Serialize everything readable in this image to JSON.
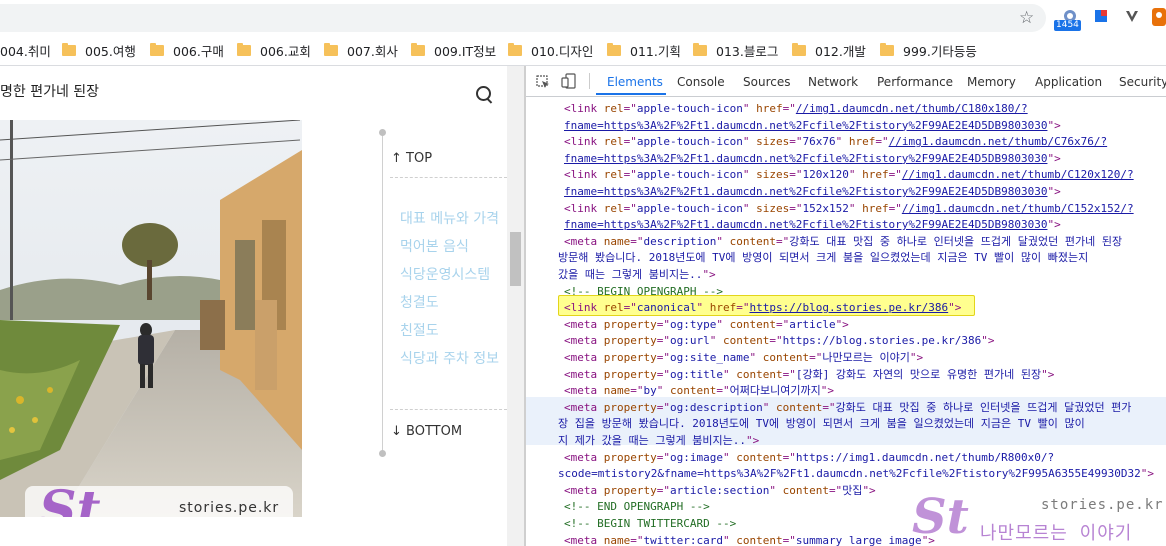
{
  "toolbar": {
    "extension_badge": "1454"
  },
  "bookmarks": [
    {
      "label": "004.취미"
    },
    {
      "label": "005.여행"
    },
    {
      "label": "006.구매"
    },
    {
      "label": "006.교회"
    },
    {
      "label": "007.회사"
    },
    {
      "label": "009.IT정보"
    },
    {
      "label": "010.디자인"
    },
    {
      "label": "011.기획"
    },
    {
      "label": "013.블로그"
    },
    {
      "label": "012.개발"
    },
    {
      "label": "999.기타등등"
    }
  ],
  "blog": {
    "title": "명한 편가네 된장",
    "toc_top": "↑ TOP",
    "toc_bottom": "↓ BOTTOM",
    "toc_items": [
      "대표 메뉴와 가격",
      "먹어본 음식",
      "식당운영시스템",
      "청결도",
      "친절도",
      "식당과 주차 정보"
    ],
    "watermark": {
      "logo": "St",
      "domain": "stories.pe.kr",
      "name": "나만모르는 이야기"
    }
  },
  "devtools": {
    "tabs": [
      "Elements",
      "Console",
      "Sources",
      "Network",
      "Performance",
      "Memory",
      "Application",
      "Security"
    ],
    "active_tab": "Elements",
    "lines": [
      [
        [
          "tag",
          "<link "
        ],
        [
          "attr",
          "rel"
        ],
        [
          "tag",
          "=\""
        ],
        [
          "val",
          "apple-touch-icon"
        ],
        [
          "tag",
          "\" "
        ],
        [
          "attr",
          "href"
        ],
        [
          "tag",
          "=\""
        ],
        [
          "link",
          "//img1.daumcdn.net/thumb/C180x180/?"
        ]
      ],
      [
        [
          "link",
          "fname=https%3A%2F%2Ft1.daumcdn.net%2Fcfile%2Ftistory%2F99AE2E4D5DB9803030"
        ],
        [
          "tag",
          "\">"
        ]
      ],
      [
        [
          "tag",
          "<link "
        ],
        [
          "attr",
          "rel"
        ],
        [
          "tag",
          "=\""
        ],
        [
          "val",
          "apple-touch-icon"
        ],
        [
          "tag",
          "\" "
        ],
        [
          "attr",
          "sizes"
        ],
        [
          "tag",
          "=\""
        ],
        [
          "val",
          "76x76"
        ],
        [
          "tag",
          "\" "
        ],
        [
          "attr",
          "href"
        ],
        [
          "tag",
          "=\""
        ],
        [
          "link",
          "//img1.daumcdn.net/thumb/C76x76/?"
        ]
      ],
      [
        [
          "link",
          "fname=https%3A%2F%2Ft1.daumcdn.net%2Fcfile%2Ftistory%2F99AE2E4D5DB9803030"
        ],
        [
          "tag",
          "\">"
        ]
      ],
      [
        [
          "tag",
          "<link "
        ],
        [
          "attr",
          "rel"
        ],
        [
          "tag",
          "=\""
        ],
        [
          "val",
          "apple-touch-icon"
        ],
        [
          "tag",
          "\" "
        ],
        [
          "attr",
          "sizes"
        ],
        [
          "tag",
          "=\""
        ],
        [
          "val",
          "120x120"
        ],
        [
          "tag",
          "\" "
        ],
        [
          "attr",
          "href"
        ],
        [
          "tag",
          "=\""
        ],
        [
          "link",
          "//img1.daumcdn.net/thumb/C120x120/?"
        ]
      ],
      [
        [
          "link",
          "fname=https%3A%2F%2Ft1.daumcdn.net%2Fcfile%2Ftistory%2F99AE2E4D5DB9803030"
        ],
        [
          "tag",
          "\">"
        ]
      ],
      [
        [
          "tag",
          "<link "
        ],
        [
          "attr",
          "rel"
        ],
        [
          "tag",
          "=\""
        ],
        [
          "val",
          "apple-touch-icon"
        ],
        [
          "tag",
          "\" "
        ],
        [
          "attr",
          "sizes"
        ],
        [
          "tag",
          "=\""
        ],
        [
          "val",
          "152x152"
        ],
        [
          "tag",
          "\" "
        ],
        [
          "attr",
          "href"
        ],
        [
          "tag",
          "=\""
        ],
        [
          "link",
          "//img1.daumcdn.net/thumb/C152x152/?"
        ]
      ],
      [
        [
          "link",
          "fname=https%3A%2F%2Ft1.daumcdn.net%2Fcfile%2Ftistory%2F99AE2E4D5DB9803030"
        ],
        [
          "tag",
          "\">"
        ]
      ],
      [
        [
          "tag",
          "<meta "
        ],
        [
          "attr",
          "name"
        ],
        [
          "tag",
          "=\""
        ],
        [
          "val",
          "description"
        ],
        [
          "tag",
          "\" "
        ],
        [
          "attr",
          "content"
        ],
        [
          "tag",
          "=\""
        ],
        [
          "val",
          "강화도 대표 맛집 중 하나로 인터넷을 뜨겁게 달궜었던 편가네 된장"
        ]
      ],
      [
        [
          "val",
          "방문해 봤습니다. 2018년도에 TV에 방영이 되면서 크게 붐을 일으켰었는데 지금은 TV 빨이 많이 빠졌는지"
        ]
      ],
      [
        [
          "val",
          "갔을 때는 그렇게 붐비지는.."
        ],
        [
          "tag",
          "\">"
        ]
      ],
      [
        [
          "cmt",
          "<!-- BEGIN OPENGRAPH -->"
        ]
      ],
      [
        [
          "tag",
          "<link "
        ],
        [
          "attr",
          "rel"
        ],
        [
          "tag",
          "=\""
        ],
        [
          "val",
          "canonical"
        ],
        [
          "tag",
          "\" "
        ],
        [
          "attr",
          "href"
        ],
        [
          "tag",
          "=\""
        ],
        [
          "link",
          "https://blog.stories.pe.kr/386"
        ],
        [
          "tag",
          "\">"
        ]
      ],
      [
        [
          "tag",
          "<meta "
        ],
        [
          "attr",
          "property"
        ],
        [
          "tag",
          "=\""
        ],
        [
          "val",
          "og:type"
        ],
        [
          "tag",
          "\" "
        ],
        [
          "attr",
          "content"
        ],
        [
          "tag",
          "=\""
        ],
        [
          "val",
          "article"
        ],
        [
          "tag",
          "\">"
        ]
      ],
      [
        [
          "tag",
          "<meta "
        ],
        [
          "attr",
          "property"
        ],
        [
          "tag",
          "=\""
        ],
        [
          "val",
          "og:url"
        ],
        [
          "tag",
          "\" "
        ],
        [
          "attr",
          "content"
        ],
        [
          "tag",
          "=\""
        ],
        [
          "val",
          "https://blog.stories.pe.kr/386"
        ],
        [
          "tag",
          "\">"
        ]
      ],
      [
        [
          "tag",
          "<meta "
        ],
        [
          "attr",
          "property"
        ],
        [
          "tag",
          "=\""
        ],
        [
          "val",
          "og:site_name"
        ],
        [
          "tag",
          "\" "
        ],
        [
          "attr",
          "content"
        ],
        [
          "tag",
          "=\""
        ],
        [
          "val",
          "나만모르는 이야기"
        ],
        [
          "tag",
          "\">"
        ]
      ],
      [
        [
          "tag",
          "<meta "
        ],
        [
          "attr",
          "property"
        ],
        [
          "tag",
          "=\""
        ],
        [
          "val",
          "og:title"
        ],
        [
          "tag",
          "\" "
        ],
        [
          "attr",
          "content"
        ],
        [
          "tag",
          "=\""
        ],
        [
          "val",
          "[강화] 강화도 자연의 맛으로 유명한 편가네 된장"
        ],
        [
          "tag",
          "\">"
        ]
      ],
      [
        [
          "tag",
          "<meta "
        ],
        [
          "attr",
          "name"
        ],
        [
          "tag",
          "=\""
        ],
        [
          "val",
          "by"
        ],
        [
          "tag",
          "\" "
        ],
        [
          "attr",
          "content"
        ],
        [
          "tag",
          "=\""
        ],
        [
          "val",
          "어쩌다보니여기까지"
        ],
        [
          "tag",
          "\">"
        ]
      ],
      [
        [
          "tag",
          "<meta "
        ],
        [
          "attr",
          "property"
        ],
        [
          "tag",
          "=\""
        ],
        [
          "val",
          "og:description"
        ],
        [
          "tag",
          "\" "
        ],
        [
          "attr",
          "content"
        ],
        [
          "tag",
          "=\""
        ],
        [
          "val",
          "강화도 대표 맛집 중 하나로 인터넷을 뜨겁게 달궜었던 편가"
        ]
      ],
      [
        [
          "val",
          "장 집을 방문해 봤습니다. 2018년도에 TV에 방영이 되면서 크게 붐을 일으켰었는데 지금은 TV 빨이 많이"
        ]
      ],
      [
        [
          "val",
          "지 제가 갔을 때는 그렇게 붐비지는.."
        ],
        [
          "tag",
          "\">"
        ]
      ],
      [
        [
          "tag",
          "<meta "
        ],
        [
          "attr",
          "property"
        ],
        [
          "tag",
          "=\""
        ],
        [
          "val",
          "og:image"
        ],
        [
          "tag",
          "\" "
        ],
        [
          "attr",
          "content"
        ],
        [
          "tag",
          "=\""
        ],
        [
          "val",
          "https://img1.daumcdn.net/thumb/R800x0/?"
        ]
      ],
      [
        [
          "val",
          "scode=mtistory2&fname=https%3A%2F%2Ft1.daumcdn.net%2Fcfile%2Ftistory%2F995A6355E49930D32"
        ],
        [
          "tag",
          "\">"
        ]
      ],
      [
        [
          "tag",
          "<meta "
        ],
        [
          "attr",
          "property"
        ],
        [
          "tag",
          "=\""
        ],
        [
          "val",
          "article:section"
        ],
        [
          "tag",
          "\" "
        ],
        [
          "attr",
          "content"
        ],
        [
          "tag",
          "=\""
        ],
        [
          "val",
          "맛집"
        ],
        [
          "tag",
          "\">"
        ]
      ],
      [
        [
          "cmt",
          "<!-- END OPENGRAPH -->"
        ]
      ],
      [
        [
          "cmt",
          "<!-- BEGIN TWITTERCARD -->"
        ]
      ],
      [
        [
          "tag",
          "<meta "
        ],
        [
          "attr",
          "name"
        ],
        [
          "tag",
          "=\""
        ],
        [
          "val",
          "twitter:card"
        ],
        [
          "tag",
          "\" "
        ],
        [
          "attr",
          "content"
        ],
        [
          "tag",
          "=\""
        ],
        [
          "val",
          "summary_large_image"
        ],
        [
          "tag",
          "\">"
        ]
      ]
    ]
  }
}
